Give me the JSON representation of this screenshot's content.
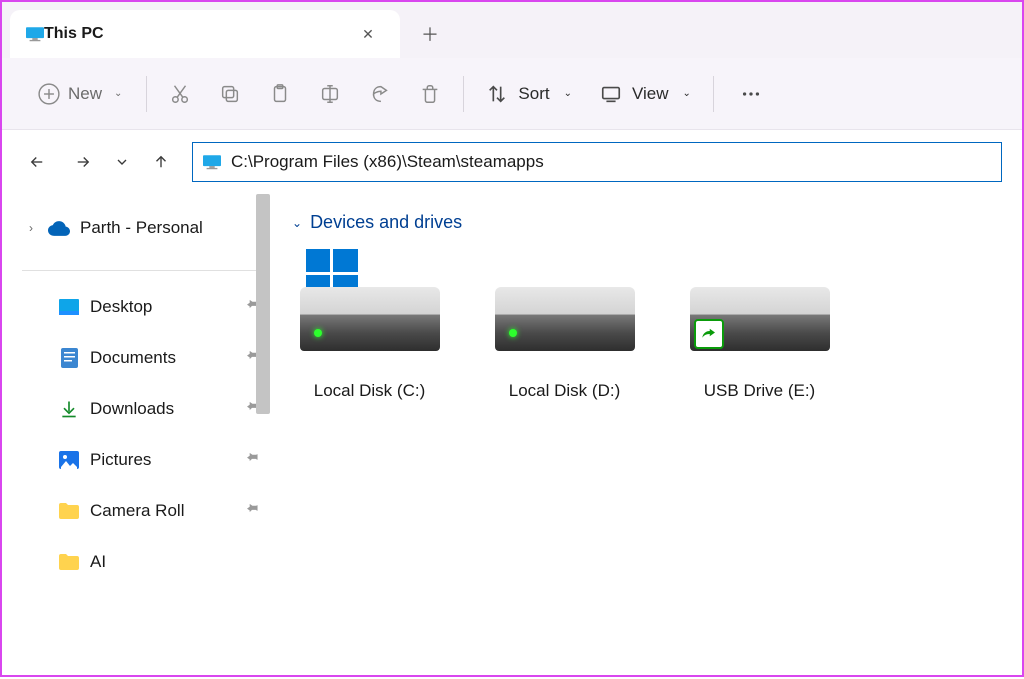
{
  "tab": {
    "title": "This PC"
  },
  "toolbar": {
    "new_label": "New",
    "sort_label": "Sort",
    "view_label": "View"
  },
  "nav": {
    "address": "C:\\Program Files (x86)\\Steam\\steamapps"
  },
  "sidebar": {
    "top_item": "Parth - Personal",
    "quick_items": [
      {
        "label": "Desktop",
        "icon": "desktop"
      },
      {
        "label": "Documents",
        "icon": "documents"
      },
      {
        "label": "Downloads",
        "icon": "downloads"
      },
      {
        "label": "Pictures",
        "icon": "pictures"
      },
      {
        "label": "Camera Roll",
        "icon": "folder"
      },
      {
        "label": "AI",
        "icon": "folder"
      }
    ]
  },
  "content": {
    "section_title": "Devices and drives",
    "drives": [
      {
        "label": "Local Disk (C:)",
        "is_os": true,
        "shared": false
      },
      {
        "label": "Local Disk (D:)",
        "is_os": false,
        "shared": false
      },
      {
        "label": "USB Drive (E:)",
        "is_os": false,
        "shared": true
      }
    ]
  }
}
